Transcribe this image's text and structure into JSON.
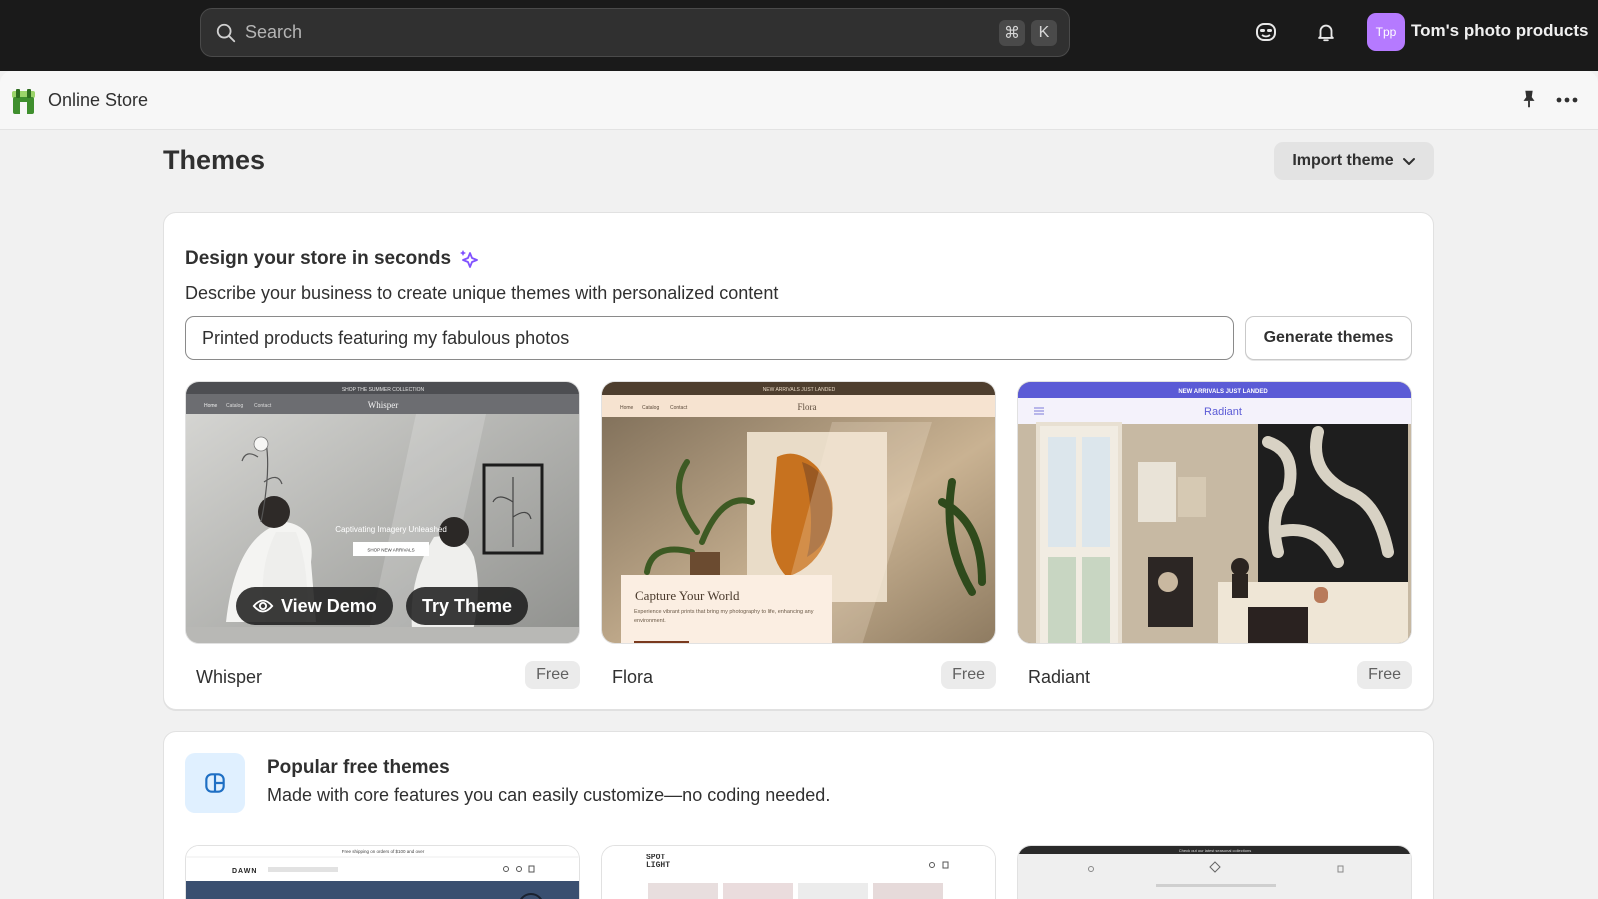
{
  "topbar": {
    "search_placeholder": "Search",
    "shortcut_keys": [
      "⌘",
      "K"
    ],
    "avatar_initials": "Tpp",
    "store_name": "Tom's photo products",
    "icons": [
      "search-icon",
      "sidekick-icon",
      "bell-icon"
    ]
  },
  "subheader": {
    "app_title": "Online Store",
    "icons": [
      "online-store-icon",
      "pin-icon",
      "more-icon"
    ]
  },
  "page": {
    "title": "Themes",
    "import_label": "Import theme"
  },
  "design_card": {
    "title": "Design your store in seconds",
    "description": "Describe your business to create unique themes with personalized content",
    "prompt_value": "Printed products featuring my fabulous photos",
    "generate_label": "Generate themes",
    "overlay": {
      "view_demo_label": "View Demo",
      "try_theme_label": "Try Theme"
    },
    "themes": [
      {
        "name": "Whisper",
        "badge": "Free",
        "preview": {
          "banner": "SHOP THE SUMMER COLLECTION",
          "nav": [
            "Home",
            "Catalog",
            "Contact"
          ],
          "logo": "Whisper",
          "hero_text": "Captivating Imagery Unleashed",
          "hero_button": "SHOP NEW ARRIVALS"
        }
      },
      {
        "name": "Flora",
        "badge": "Free",
        "preview": {
          "banner": "NEW ARRIVALS JUST LANDED",
          "nav": [
            "Home",
            "Catalog",
            "Contact"
          ],
          "logo": "Flora",
          "hero_title": "Capture Your World",
          "hero_text": "Experience vibrant prints that bring my photography to life, enhancing any environment."
        }
      },
      {
        "name": "Radiant",
        "badge": "Free",
        "preview": {
          "banner": "NEW ARRIVALS JUST LANDED",
          "logo": "Radiant"
        }
      }
    ]
  },
  "popular_card": {
    "title": "Popular free themes",
    "description": "Made with core features you can easily customize—no coding needed.",
    "previews": [
      {
        "logo": "DAWN",
        "banner": "Free shipping on orders of $100 and over"
      },
      {
        "logo": "SPOT LIGHT"
      },
      {
        "banner": "Check out our latest seasonal collections"
      }
    ]
  },
  "colors": {
    "topbar_bg": "#1a1a1a",
    "page_bg": "#f1f1f1",
    "avatar_bg": "#b57aff",
    "radiant_accent": "#5b5bd6",
    "sparkle": "#8051ff"
  }
}
